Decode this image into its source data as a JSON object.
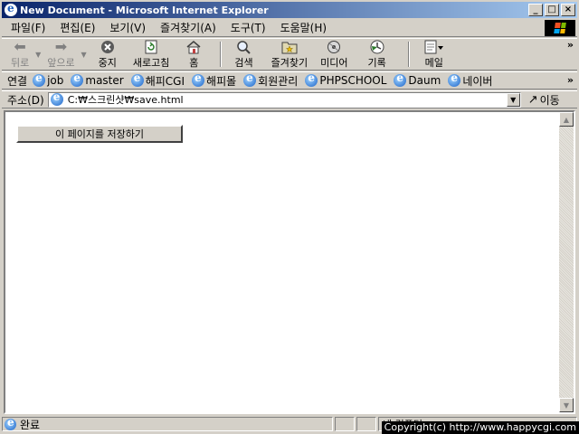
{
  "window": {
    "title": "New Document - Microsoft Internet Explorer",
    "caption_buttons": {
      "minimize": "_",
      "maximize": "□",
      "close": "×"
    }
  },
  "menu": {
    "items": [
      "파일(F)",
      "편집(E)",
      "보기(V)",
      "즐겨찾기(A)",
      "도구(T)",
      "도움말(H)"
    ]
  },
  "toolbar": {
    "back": "뒤로",
    "forward": "앞으로",
    "stop": "중지",
    "refresh": "새로고침",
    "home": "홈",
    "search": "검색",
    "favorites": "즐겨찾기",
    "media": "미디어",
    "history": "기록",
    "mail": "메일",
    "overflow": "»"
  },
  "links": {
    "label": "연결",
    "items": [
      "job",
      "master",
      "해피CGI",
      "해피몰",
      "회원관리",
      "PHPSCHOOL",
      "Daum",
      "네이버"
    ],
    "overflow": "»"
  },
  "address": {
    "label": "주소(D)",
    "value": "C:₩스크린샷₩save.html",
    "go_label": "이동"
  },
  "page": {
    "save_button_label": "이 페이지를 저장하기"
  },
  "status": {
    "text": "완료",
    "zone": "내 컴퓨터",
    "copyright": "Copyright(c) http://www.happycgi.com"
  }
}
